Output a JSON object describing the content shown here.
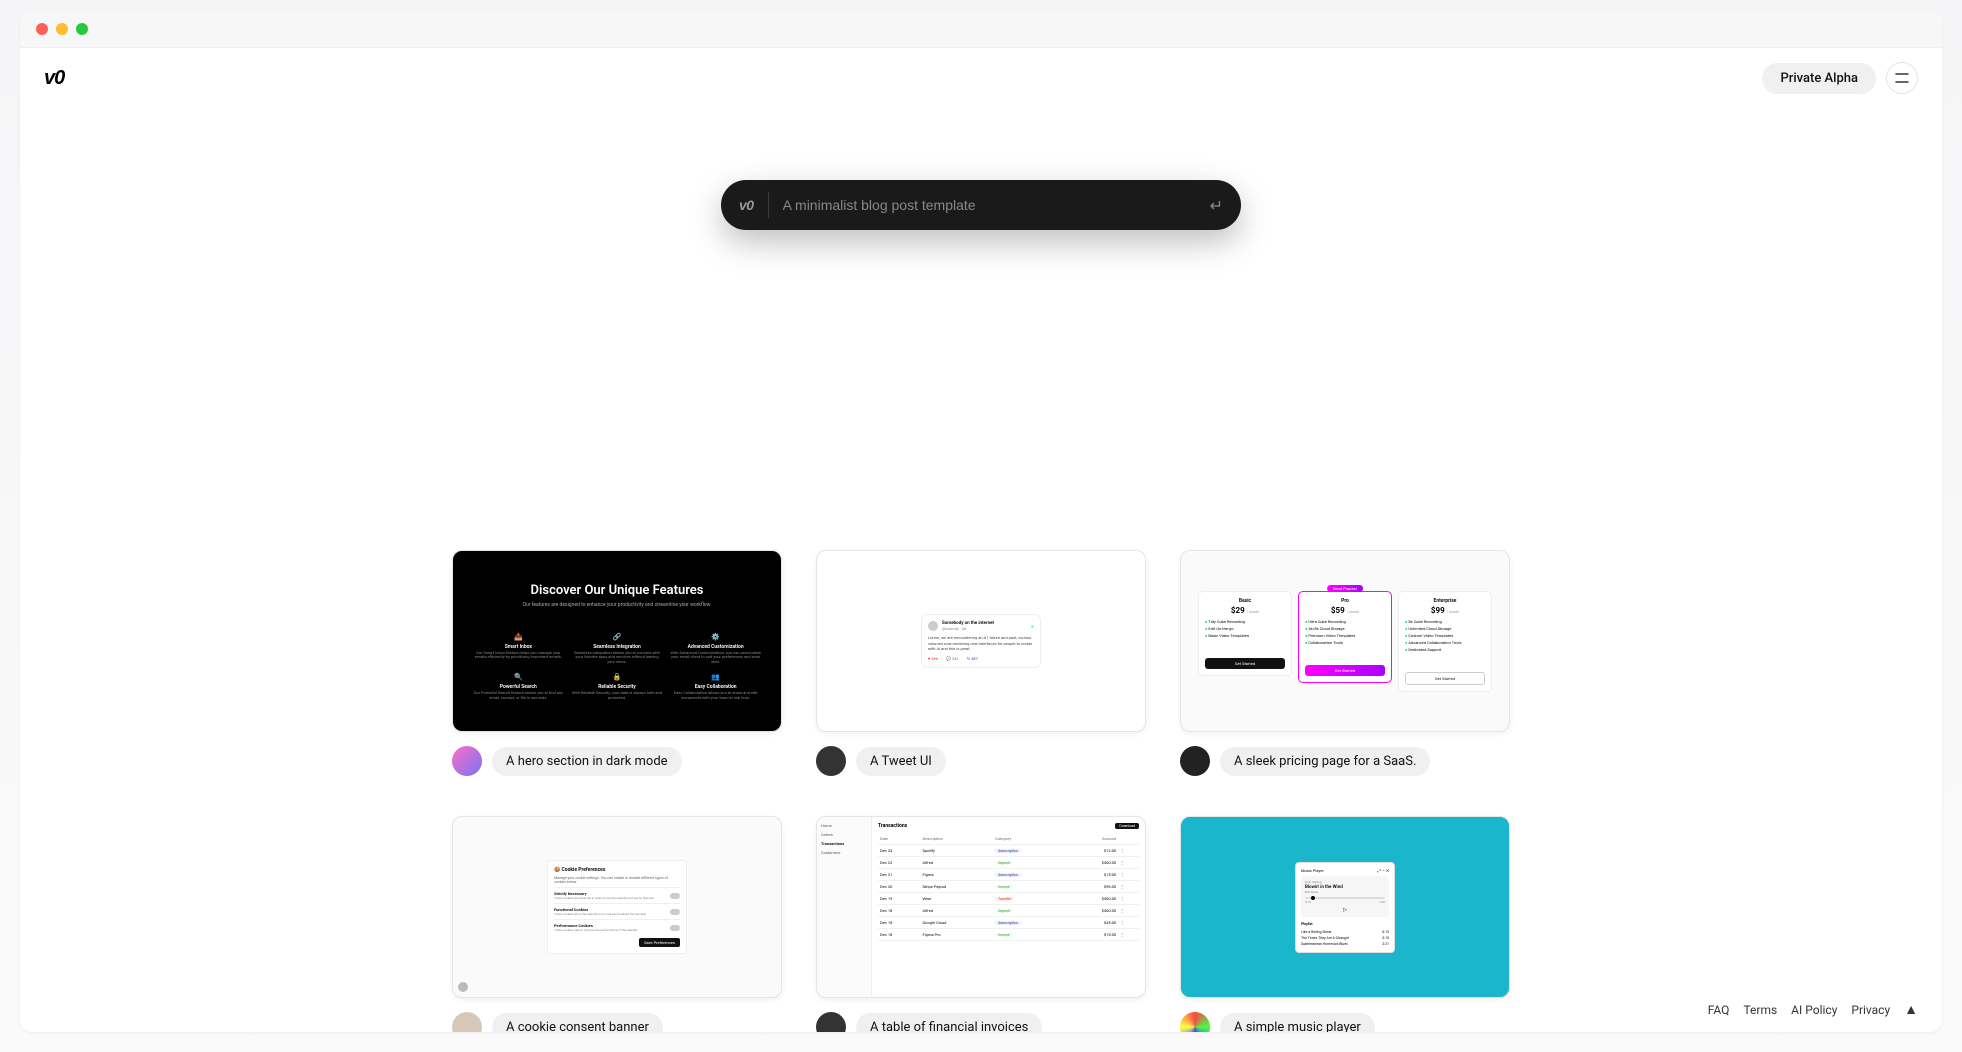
{
  "header": {
    "badge": "Private Alpha"
  },
  "prompt": {
    "placeholder": "A minimalist blog post template"
  },
  "cards": [
    {
      "caption": "A hero section in dark mode"
    },
    {
      "caption": "A Tweet UI"
    },
    {
      "caption": "A sleek pricing page for a SaaS."
    },
    {
      "caption": "A cookie consent banner"
    },
    {
      "caption": "A table of financial invoices"
    },
    {
      "caption": "A simple music player"
    }
  ],
  "thumb_hero": {
    "title": "Discover Our Unique Features",
    "subtitle": "Our features are designed to enhance your productivity and streamline your workflow.",
    "features": [
      {
        "name": "Smart Inbox",
        "desc": "Our Smart Inbox feature helps you manage your emails efficiently by prioritizing important emails."
      },
      {
        "name": "Seamless Integration",
        "desc": "Seamless Integration allows you to connect with your favorite apps and services without leaving your inbox."
      },
      {
        "name": "Advanced Customization",
        "desc": "With Advanced Customization, you can personalize your email client to suit your preferences and work style."
      },
      {
        "name": "Powerful Search",
        "desc": "Our Powerful Search feature allows you to find any email, contact, or file in seconds."
      },
      {
        "name": "Reliable Security",
        "desc": "With Reliable Security, your data is always safe and protected."
      },
      {
        "name": "Easy Collaboration",
        "desc": "Easy Collaboration allows you to share and edit documents with your team in real time."
      }
    ]
  },
  "thumb_tweet": {
    "name": "Somebody on the internet",
    "handle": "@nobody · 3h",
    "text": "Lorem, we are encountering an A1 future and past, curious volumes now rendering new interfaces for people to create with AI and this is great."
  },
  "thumb_pricing": {
    "cols": [
      {
        "name": "Basic",
        "price": "$29",
        "per": "/ month",
        "features": [
          "Tidy Cube Recording",
          "Edit On-the-go",
          "Basic Video Templates"
        ],
        "btn": "Get Started",
        "variant": "dark"
      },
      {
        "name": "Pro",
        "price": "$59",
        "per": "/ month",
        "features": [
          "Ultra Cube Recording",
          "4k/8k Cloud Storage",
          "Premium Video Templates",
          "Collaboration Tools"
        ],
        "btn": "Get Started",
        "variant": "pop",
        "tag": "Most Popular"
      },
      {
        "name": "Enterprise",
        "price": "$99",
        "per": "/ month",
        "features": [
          "8k Cube Recording",
          "Unlimited Cloud Storage",
          "Custom Video Templates",
          "Advanced Collaboration Tools",
          "Dedicated Support"
        ],
        "btn": "Get Started",
        "variant": "outline"
      }
    ]
  },
  "thumb_cookie": {
    "title": "🍪 Cookie Preferences",
    "desc": "Manage your cookie settings. You can enable or disable different types of cookies below.",
    "rows": [
      {
        "name": "Strictly Necessary",
        "desc": "These cookies are essential in order to use the website and use its features."
      },
      {
        "name": "Functional Cookies",
        "desc": "These cookies allow the website to provide personalized functionality."
      },
      {
        "name": "Performance Cookies",
        "desc": "These cookies help to improve the performance of the website."
      }
    ],
    "btn": "Save Preferences"
  },
  "thumb_table": {
    "side": [
      "Home",
      "Orders",
      "Transactions",
      "Customers"
    ],
    "side_active": 2,
    "title": "Transactions",
    "download": "Download",
    "cols": [
      "Date",
      "Description",
      "Category",
      "Amount",
      ""
    ],
    "rows": [
      {
        "date": "Dec 23",
        "desc": "Spotify",
        "cat": "Subscription",
        "catc": "blue",
        "amt": "$12.00"
      },
      {
        "date": "Dec 22",
        "desc": "Alfred",
        "cat": "Deposit",
        "catc": "green",
        "amt": "$300.00"
      },
      {
        "date": "Dec 21",
        "desc": "Figma",
        "cat": "Subscription",
        "catc": "blue",
        "amt": "$15.00"
      },
      {
        "date": "Dec 20",
        "desc": "Stripe Payout",
        "cat": "Income",
        "catc": "green",
        "amt": "$96.00"
      },
      {
        "date": "Dec 19",
        "desc": "Wise",
        "cat": "Transfer",
        "catc": "red",
        "amt": "$300.00"
      },
      {
        "date": "Dec 18",
        "desc": "Alfred",
        "cat": "Deposit",
        "catc": "green",
        "amt": "$300.00"
      },
      {
        "date": "Dec 18",
        "desc": "Google Cloud",
        "cat": "Subscription",
        "catc": "blue",
        "amt": "$45.00"
      },
      {
        "date": "Dec 18",
        "desc": "Figma Pro",
        "cat": "Income",
        "catc": "green",
        "amt": "$15.00"
      }
    ]
  },
  "thumb_music": {
    "head": "Music Player",
    "np_label": "Now Playing",
    "song": "Blowin' in the Wind",
    "artist": "Bob Dylan",
    "time_l": "0:18",
    "time_r": "2:48",
    "playlist_title": "Playlist",
    "playlist": [
      {
        "t": "Like a Rolling Stone",
        "d": "6:13"
      },
      {
        "t": "The Times They Are A-Changin'",
        "d": "3:15"
      },
      {
        "t": "Subterranean Homesick Blues",
        "d": "2:21"
      }
    ]
  },
  "footer": {
    "links": [
      "FAQ",
      "Terms",
      "AI Policy",
      "Privacy"
    ]
  },
  "avatars": [
    {
      "bg": "linear-gradient(135deg,#ff6ec4,#7873f5)"
    },
    {
      "bg": "#333"
    },
    {
      "bg": "#222"
    },
    {
      "bg": "#444"
    },
    {
      "bg": "#333"
    },
    {
      "bg": "conic-gradient(#f44,#4f4,#44f,#ff4,#f44)"
    }
  ]
}
